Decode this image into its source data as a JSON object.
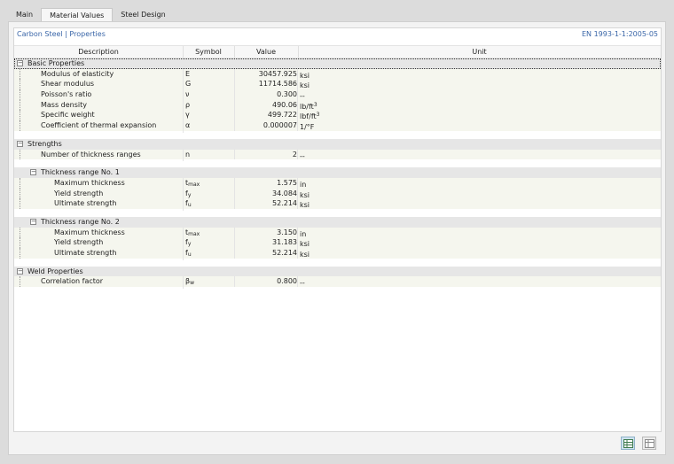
{
  "tabs": [
    {
      "label": "Main"
    },
    {
      "label": "Material Values"
    },
    {
      "label": "Steel Design"
    }
  ],
  "active_tab": "Material Values",
  "panel": {
    "title": "Carbon Steel | Properties",
    "standard": "EN 1993-1-1:2005-05"
  },
  "columns": {
    "description": "Description",
    "symbol": "Symbol",
    "value": "Value",
    "unit": "Unit"
  },
  "sections": [
    {
      "label": "Basic Properties",
      "rows": [
        {
          "desc": "Modulus of elasticity",
          "sym": "E",
          "sym_sub": "",
          "value": "30457.925",
          "unit": "ksi",
          "unit_sup": ""
        },
        {
          "desc": "Shear modulus",
          "sym": "G",
          "sym_sub": "",
          "value": "11714.586",
          "unit": "ksi",
          "unit_sup": ""
        },
        {
          "desc": "Poisson's ratio",
          "sym": "ν",
          "sym_sub": "",
          "value": "0.300",
          "unit": "--",
          "unit_sup": ""
        },
        {
          "desc": "Mass density",
          "sym": "ρ",
          "sym_sub": "",
          "value": "490.06",
          "unit": "lb/ft",
          "unit_sup": "3"
        },
        {
          "desc": "Specific weight",
          "sym": "γ",
          "sym_sub": "",
          "value": "499.722",
          "unit": "lbf/ft",
          "unit_sup": "3"
        },
        {
          "desc": "Coefficient of thermal expansion",
          "sym": "α",
          "sym_sub": "",
          "value": "0.000007",
          "unit": "1/°F",
          "unit_sup": ""
        }
      ]
    },
    {
      "label": "Strengths",
      "rows": [
        {
          "desc": "Number of thickness ranges",
          "sym": "n",
          "sym_sub": "",
          "value": "2",
          "unit": "--",
          "unit_sup": ""
        }
      ],
      "subsections": [
        {
          "label": "Thickness range No. 1",
          "rows": [
            {
              "desc": "Maximum thickness",
              "sym": "t",
              "sym_sub": "max",
              "value": "1.575",
              "unit": "in",
              "unit_sup": ""
            },
            {
              "desc": "Yield strength",
              "sym": "f",
              "sym_sub": "y",
              "value": "34.084",
              "unit": "ksi",
              "unit_sup": ""
            },
            {
              "desc": "Ultimate strength",
              "sym": "f",
              "sym_sub": "u",
              "value": "52.214",
              "unit": "ksi",
              "unit_sup": ""
            }
          ]
        },
        {
          "label": "Thickness range No. 2",
          "rows": [
            {
              "desc": "Maximum thickness",
              "sym": "t",
              "sym_sub": "max",
              "value": "3.150",
              "unit": "in",
              "unit_sup": ""
            },
            {
              "desc": "Yield strength",
              "sym": "f",
              "sym_sub": "y",
              "value": "31.183",
              "unit": "ksi",
              "unit_sup": ""
            },
            {
              "desc": "Ultimate strength",
              "sym": "f",
              "sym_sub": "u",
              "value": "52.214",
              "unit": "ksi",
              "unit_sup": ""
            }
          ]
        }
      ]
    },
    {
      "label": "Weld Properties",
      "rows": [
        {
          "desc": "Correlation factor",
          "sym": "β",
          "sym_sub": "w",
          "value": "0.800",
          "unit": "--",
          "unit_sup": ""
        }
      ]
    }
  ],
  "toggle_glyph": "−",
  "icons": {
    "button1": "table-view-icon",
    "button2": "table-export-icon"
  },
  "colors": {
    "title_blue": "#3a66a8",
    "row_bg": "#f5f6ee",
    "section_bg": "#e6e6e6"
  }
}
